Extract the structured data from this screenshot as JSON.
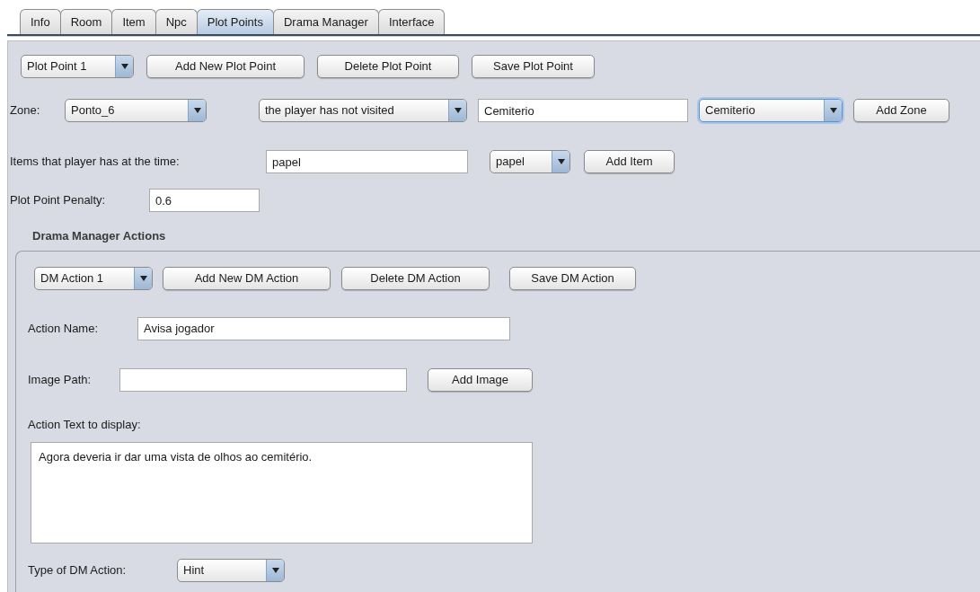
{
  "tabs": [
    {
      "label": "Info",
      "selected": false
    },
    {
      "label": "Room",
      "selected": false
    },
    {
      "label": "Item",
      "selected": false
    },
    {
      "label": "Npc",
      "selected": false
    },
    {
      "label": "Plot Points",
      "selected": true
    },
    {
      "label": "Drama Manager",
      "selected": false
    },
    {
      "label": "Interface",
      "selected": false
    }
  ],
  "plot_point_toolbar": {
    "selector": {
      "value": "Plot Point 1"
    },
    "buttons": [
      "Add New Plot Point",
      "Delete Plot Point",
      "Save Plot Point"
    ]
  },
  "zone_row": {
    "label": "Zone:",
    "zone_select": {
      "value": "Ponto_6"
    },
    "condition_select": {
      "value": "the player has not visited"
    },
    "zone_field": {
      "value": "Cemiterio"
    },
    "zone_options": {
      "value": "Cemiterio",
      "focused": true
    },
    "button": "Add Zone"
  },
  "items_row": {
    "label": "Items that player has at the time:",
    "field": {
      "value": "papel"
    },
    "select": {
      "value": "papel"
    },
    "button": "Add Item"
  },
  "penalty_row": {
    "label": "Plot Point Penalty:",
    "field": {
      "value": "0.6"
    }
  },
  "dm_actions": {
    "title": "Drama Manager Actions",
    "toolbar": {
      "selector": {
        "value": "DM Action 1"
      },
      "buttons": [
        "Add New DM Action",
        "Delete DM Action",
        "Save DM Action"
      ]
    },
    "action_name": {
      "label": "Action Name:",
      "value": "Avisa jogador"
    },
    "image_path": {
      "label": "Image Path:",
      "button": "Add Image"
    },
    "action_text": {
      "label": "Action Text to display:",
      "value": "Agora deveria ir dar uma vista de olhos ao cemitério."
    },
    "type": {
      "label": "Type of DM Action:",
      "value": "Hint"
    }
  }
}
